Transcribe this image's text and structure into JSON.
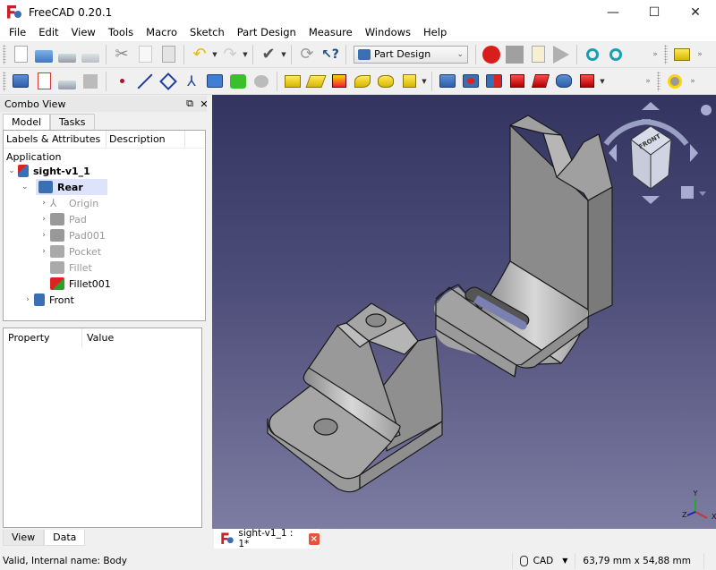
{
  "window": {
    "title": "FreeCAD 0.20.1",
    "controls": {
      "minimize": "—",
      "maximize": "☐",
      "close": "✕"
    }
  },
  "menubar": {
    "items": [
      "File",
      "Edit",
      "View",
      "Tools",
      "Macro",
      "Sketch",
      "Part Design",
      "Measure",
      "Windows",
      "Help"
    ]
  },
  "toolbar1": {
    "workbench_selector": "Part Design",
    "overflow": "»"
  },
  "toolbar2": {
    "overflow": "»"
  },
  "combo_view": {
    "title": "Combo View",
    "float_icon": "⧉",
    "close_icon": "✕",
    "tabs": [
      {
        "label": "Model",
        "active": true
      },
      {
        "label": "Tasks",
        "active": false
      }
    ],
    "tree": {
      "columns": [
        "Labels & Attributes",
        "Description"
      ],
      "root": "Application",
      "items": [
        {
          "label": "sight-v1_1",
          "expanded": true,
          "bold": true,
          "icon": "document-icon"
        },
        {
          "label": "Rear",
          "expanded": true,
          "bold": true,
          "selected": true,
          "icon": "body-icon"
        },
        {
          "label": "Origin",
          "collapsed": true,
          "muted": true,
          "icon": "origin-icon"
        },
        {
          "label": "Pad",
          "collapsed": true,
          "muted": true,
          "icon": "pad-icon"
        },
        {
          "label": "Pad001",
          "collapsed": true,
          "muted": true,
          "icon": "pad-icon"
        },
        {
          "label": "Pocket",
          "collapsed": true,
          "muted": true,
          "icon": "pocket-icon"
        },
        {
          "label": "Fillet",
          "muted": true,
          "icon": "fillet-icon"
        },
        {
          "label": "Fillet001",
          "tip": true,
          "icon": "fillet-tip-icon"
        },
        {
          "label": "Front",
          "collapsed": true,
          "icon": "body-icon"
        }
      ]
    },
    "property_panel": {
      "columns": [
        "Property",
        "Value"
      ]
    },
    "bottom_tabs": [
      {
        "label": "View",
        "active": true
      },
      {
        "label": "Data",
        "active": false
      }
    ]
  },
  "document_tab": {
    "label": "sight-v1_1 : 1*",
    "close": "×"
  },
  "viewport": {
    "axes": {
      "x": "X",
      "y": "Y",
      "z": "Z"
    },
    "navcube_face": "FRONT"
  },
  "statusbar": {
    "message": "Valid, Internal name: Body",
    "navigation_style": "CAD",
    "dimensions": "63,79 mm x 54,88 mm"
  },
  "colors": {
    "viewport_top": "#333460",
    "viewport_bottom": "#7d7ca2",
    "selection": "#dde3fb",
    "model_gray": "#a9a9a9"
  }
}
